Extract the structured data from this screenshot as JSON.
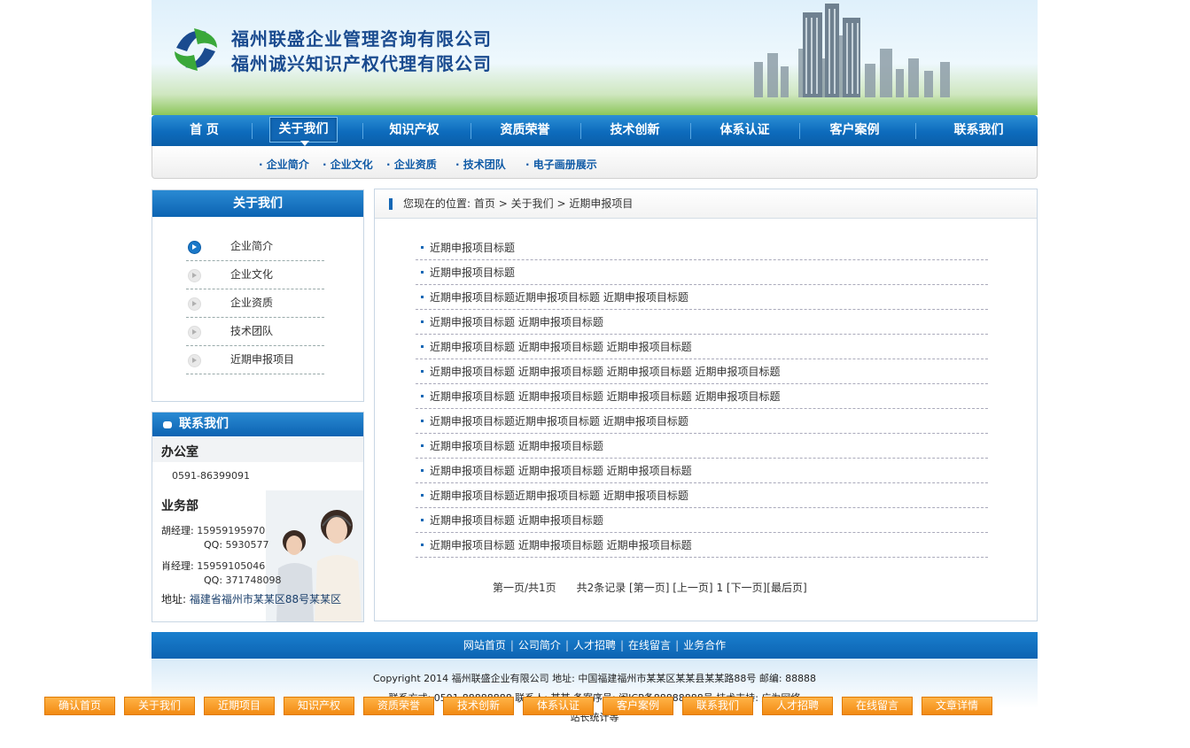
{
  "header": {
    "company_line1": "福州联盛企业管理咨询有限公司",
    "company_line2": "福州诚兴知识产权代理有限公司"
  },
  "nav": {
    "items": [
      "首 页",
      "关于我们",
      "知识产权",
      "资质荣誉",
      "技术创新",
      "体系认证",
      "客户案例",
      "联系我们"
    ],
    "active": "关于我们"
  },
  "subnav": [
    "· 企业简介",
    "· 企业文化",
    "· 企业资质",
    "· 技术团队",
    "· 电子画册展示"
  ],
  "sidebar": {
    "title": "关于我们",
    "items": [
      "企业简介",
      "企业文化",
      "企业资质",
      "技术团队",
      "近期申报项目"
    ],
    "active_index": 0
  },
  "contact": {
    "title": "联系我们",
    "office_label": "办公室",
    "office_phone": "0591-86399091",
    "biz_label": "业务部",
    "hu_label": "胡经理:",
    "hu_phone": "15959195970",
    "hu_qq_label": "QQ:",
    "hu_qq": "5930577",
    "xiao_label": "肖经理:",
    "xiao_phone": "15959105046",
    "xiao_qq_label": "QQ:",
    "xiao_qq": "371748098",
    "address_label": "地址:",
    "address": "福建省福州市某某区88号某某区"
  },
  "breadcrumb": {
    "prefix": "您现在的位置:",
    "home": "首页",
    "sep1": ">",
    "section": "关于我们",
    "sep2": ">",
    "current": "近期申报项目"
  },
  "articles": [
    "近期申报项目标题",
    "近期申报项目标题",
    "近期申报项目标题近期申报项目标题 近期申报项目标题",
    "近期申报项目标题 近期申报项目标题",
    "近期申报项目标题 近期申报项目标题 近期申报项目标题",
    "近期申报项目标题 近期申报项目标题 近期申报项目标题 近期申报项目标题",
    "近期申报项目标题 近期申报项目标题 近期申报项目标题 近期申报项目标题",
    "近期申报项目标题近期申报项目标题 近期申报项目标题",
    "近期申报项目标题 近期申报项目标题",
    "近期申报项目标题 近期申报项目标题 近期申报项目标题",
    "近期申报项目标题近期申报项目标题 近期申报项目标题",
    "近期申报项目标题 近期申报项目标题",
    "近期申报项目标题 近期申报项目标题 近期申报项目标题"
  ],
  "pager": {
    "page_info": "第一页/共1页",
    "records": "共2条记录",
    "first": "[第一页]",
    "prev": "[上一页]",
    "current": "1",
    "next": "[下一页]",
    "last": "[最后页]"
  },
  "footer": {
    "links": [
      "网站首页",
      "公司简介",
      "人才招聘",
      "在线留言",
      "业务合作"
    ],
    "divider": "|",
    "copyright": "Copyright 2014  福州联盛企业有限公司  地址: 中国福建福州市某某区某某县某某路88号  邮编: 88888",
    "contact_line": "联系方式: 0591-88888888  联系人: 某某  备案序号: 闽ICP备88888888号  技术支持: 广为网络",
    "stats": "站长统计等"
  },
  "float_bar": [
    "确认首页",
    "关于我们",
    "近期项目",
    "知识产权",
    "资质荣誉",
    "技术创新",
    "体系认证",
    "客户案例",
    "联系我们",
    "人才招聘",
    "在线留言",
    "文章详情"
  ],
  "colors": {
    "primary_blue": "#0c63b2",
    "nav_blue": "#0d6bbc",
    "link_blue": "#0f5aa6",
    "float_orange": "#f28a12"
  }
}
